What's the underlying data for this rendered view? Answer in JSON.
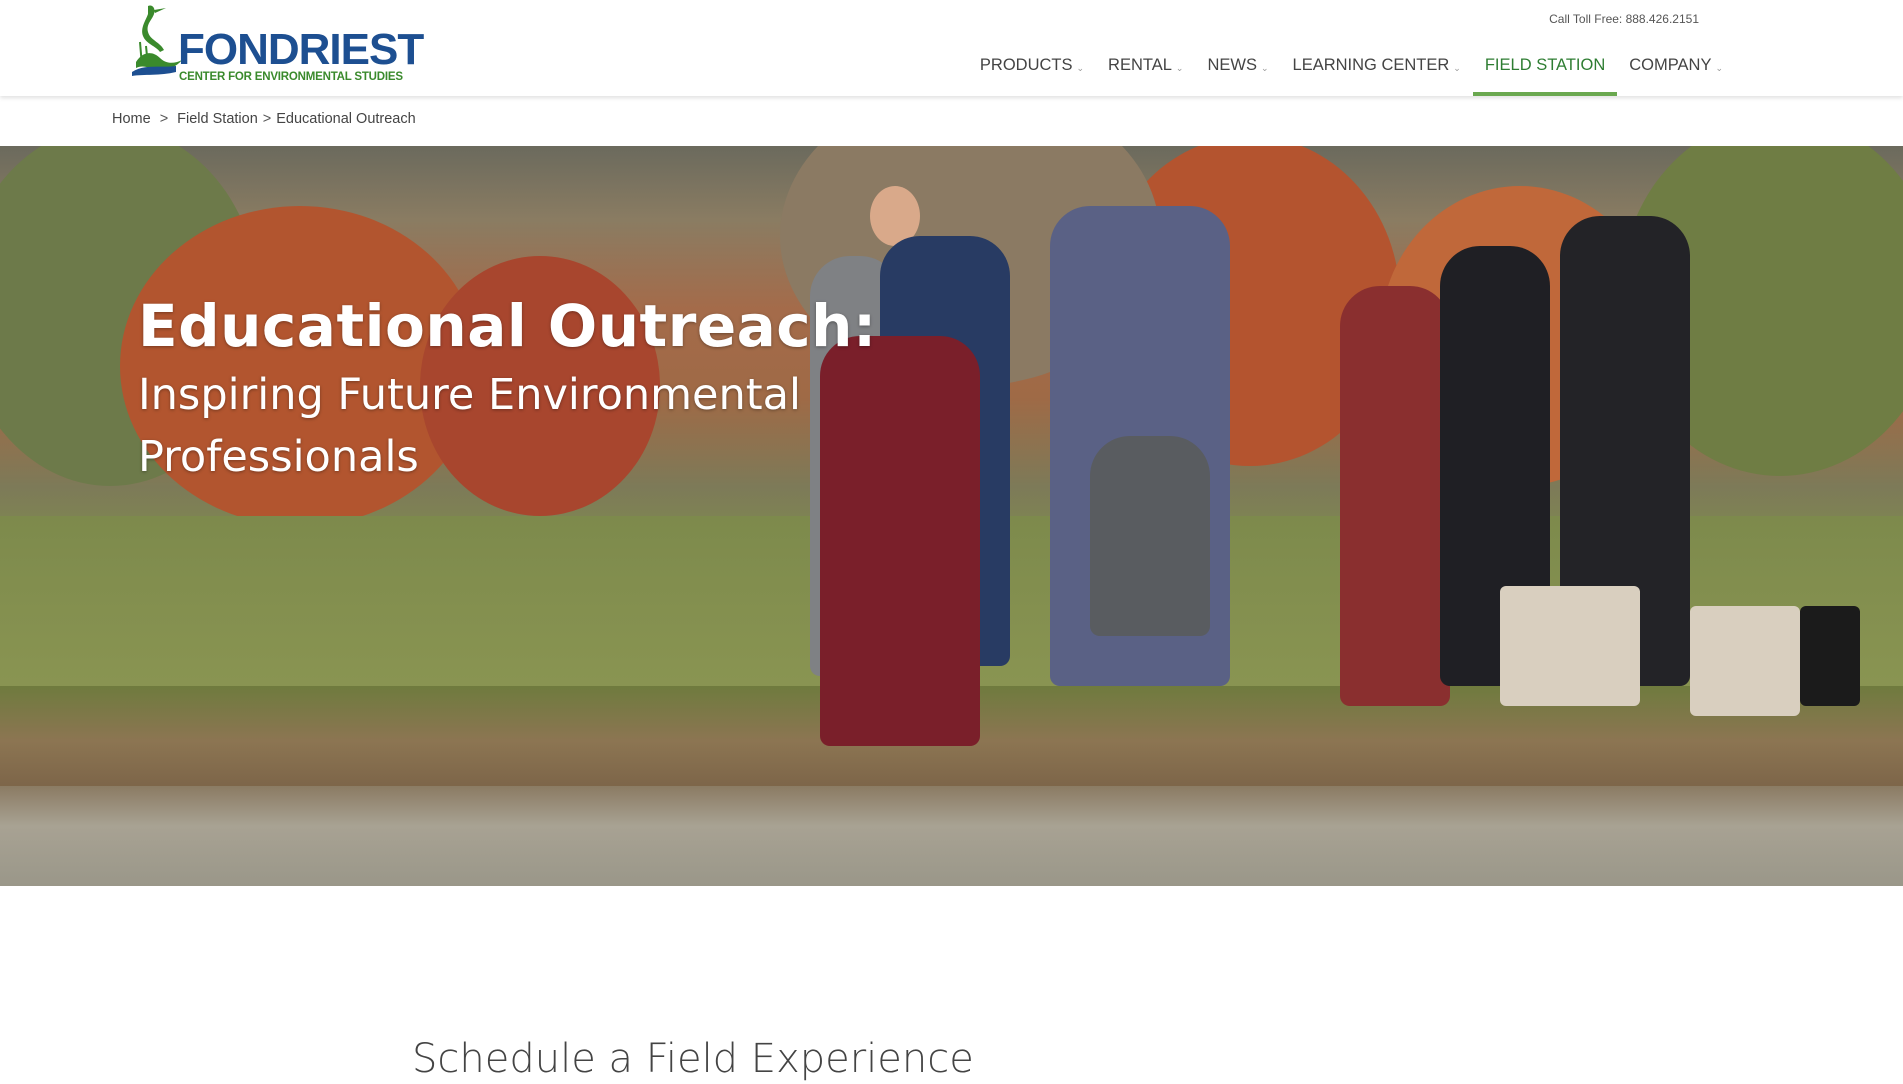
{
  "header": {
    "logo": {
      "wordmark": "FONDRIEST",
      "subtitle": "CENTER FOR ENVIRONMENTAL STUDIES",
      "brand_blue": "#1d4f91",
      "brand_green": "#3a8a2c"
    },
    "toll_free": "Call Toll Free: 888.426.2151",
    "nav": [
      {
        "label": "PRODUCTS",
        "has_dropdown": true,
        "active": false
      },
      {
        "label": "RENTAL",
        "has_dropdown": true,
        "active": false
      },
      {
        "label": "NEWS",
        "has_dropdown": true,
        "active": false
      },
      {
        "label": "LEARNING CENTER",
        "has_dropdown": true,
        "active": false
      },
      {
        "label": "FIELD STATION",
        "has_dropdown": false,
        "active": true
      },
      {
        "label": "COMPANY",
        "has_dropdown": true,
        "active": false
      }
    ],
    "chevron_icon": "chevron-down-icon",
    "active_color": "#6aa84f"
  },
  "breadcrumb": {
    "items": [
      "Home",
      "Field Station",
      "Educational Outreach"
    ],
    "separator": ">"
  },
  "hero": {
    "title": "Educational Outreach:",
    "subtitle": "Inspiring Future Environmental Professionals"
  },
  "section": {
    "heading": "Schedule a Field Experience"
  }
}
